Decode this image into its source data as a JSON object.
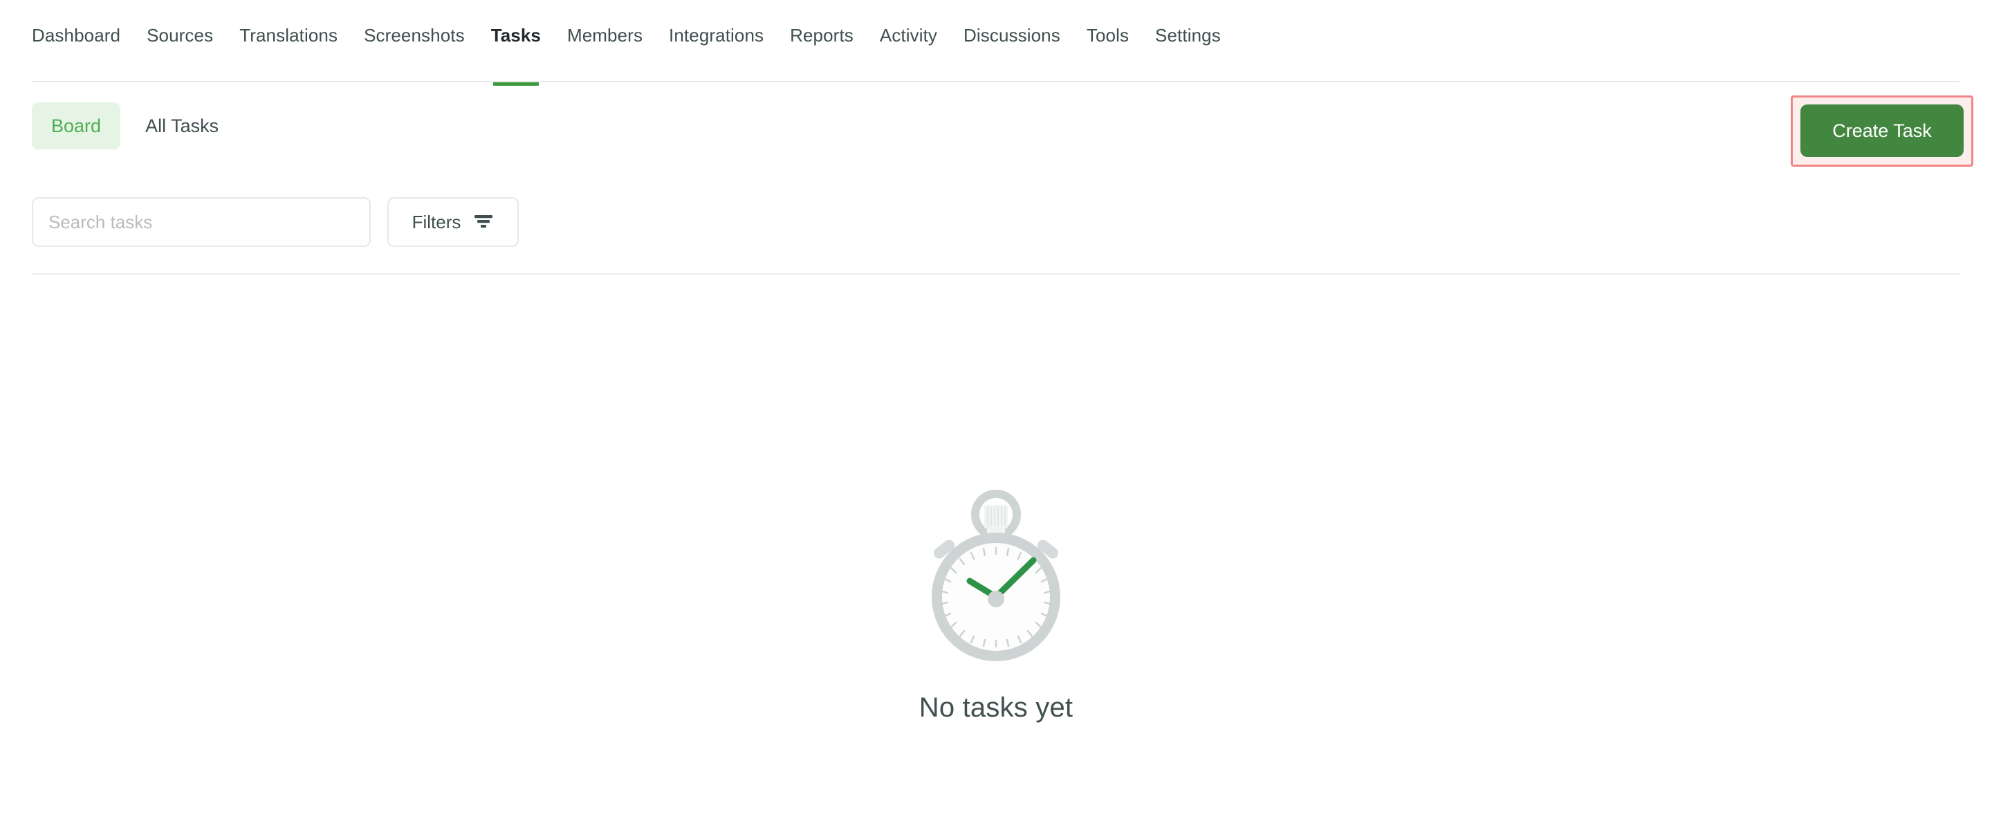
{
  "nav": {
    "items": [
      {
        "label": "Dashboard",
        "active": false
      },
      {
        "label": "Sources",
        "active": false
      },
      {
        "label": "Translations",
        "active": false
      },
      {
        "label": "Screenshots",
        "active": false
      },
      {
        "label": "Tasks",
        "active": true
      },
      {
        "label": "Members",
        "active": false
      },
      {
        "label": "Integrations",
        "active": false
      },
      {
        "label": "Reports",
        "active": false
      },
      {
        "label": "Activity",
        "active": false
      },
      {
        "label": "Discussions",
        "active": false
      },
      {
        "label": "Tools",
        "active": false
      },
      {
        "label": "Settings",
        "active": false
      }
    ],
    "active_index": 4
  },
  "toolbar": {
    "view_tabs": [
      {
        "label": "Board",
        "active": true
      },
      {
        "label": "All Tasks",
        "active": false
      }
    ],
    "create_task_label": "Create Task",
    "create_task_highlighted": true
  },
  "search": {
    "value": "",
    "placeholder": "Search tasks"
  },
  "filters": {
    "label": "Filters",
    "icon": "filter-icon"
  },
  "empty_state": {
    "illustration": "stopwatch-icon",
    "message": "No tasks yet"
  },
  "colors": {
    "accent_green": "#42863f",
    "tab_active_underline": "#3c9a3c",
    "board_tab_bg": "#e6f4e6",
    "board_tab_text": "#4caf50",
    "highlight_border": "#f28585",
    "highlight_fill": "#fdeeee",
    "divider": "#e8e9ea",
    "text_primary": "#3f4e4e",
    "placeholder": "#b8bcbf",
    "illustration_gray": "#ced3d4",
    "illustration_green": "#2e9347"
  }
}
